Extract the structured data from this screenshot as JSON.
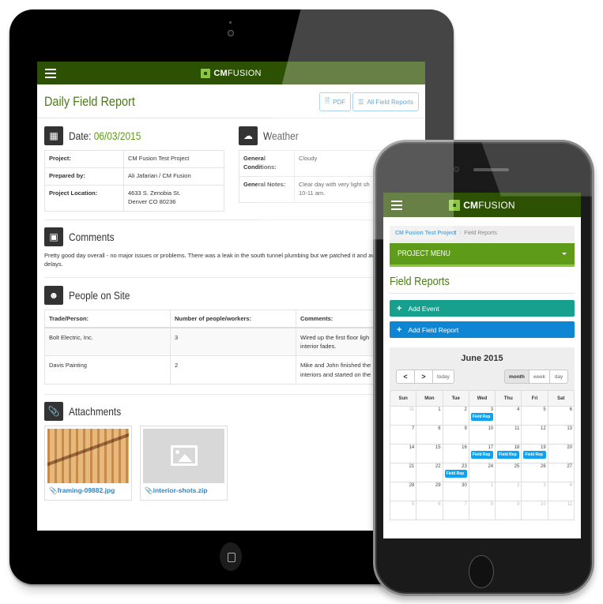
{
  "tablet": {
    "brand": {
      "bold": "CM",
      "rest": "FUSION"
    },
    "page_title": "Daily Field Report",
    "buttons": {
      "pdf": "PDF",
      "all_reports": "All Field Reports"
    },
    "date_section": {
      "label": "Date:",
      "value": "06/03/2015",
      "rows": [
        {
          "key": "Project:",
          "value": "CM Fusion Test Project"
        },
        {
          "key": "Prepared by:",
          "value": "Ali Jafarian / CM Fusion"
        },
        {
          "key": "Project Location:",
          "value": "4633 S. Zenobia St.",
          "value2": "Denver CO 80236"
        }
      ]
    },
    "weather_section": {
      "title": "Weather",
      "rows": [
        {
          "key": "General Conditions:",
          "value": "Cloudy"
        },
        {
          "key": "General Notes:",
          "value": "Clear day with very light sh",
          "value2": "10-11 am."
        }
      ]
    },
    "comments_section": {
      "title": "Comments",
      "text": "Pretty good day overall - no major issues or problems. There was a leak in the south tunnel plumbing but we patched it and avoided further delays."
    },
    "people_section": {
      "title": "People on Site",
      "headers": [
        "Trade/Person:",
        "Number of people/workers:",
        "Comments:"
      ],
      "rows": [
        {
          "trade": "Bolt Electric, Inc.",
          "count": "3",
          "comment": "Wired up the first floor ligh",
          "comment2": "interior fades."
        },
        {
          "trade": "Davis Painting",
          "count": "2",
          "comment": "Mike and John finished the",
          "comment2": "interiors and started on the"
        }
      ]
    },
    "attachments_section": {
      "title": "Attachments",
      "files": [
        {
          "name": "framing-09882.jpg",
          "thumb": "photo"
        },
        {
          "name": "interior-shots.zip",
          "thumb": "placeholder"
        }
      ]
    }
  },
  "phone": {
    "brand": {
      "bold": "CM",
      "rest": "FUSION"
    },
    "breadcrumb": {
      "project": "CM Fusion Test Project",
      "current": "Field Reports"
    },
    "project_menu": "PROJECT MENU",
    "page_title": "Field Reports",
    "buttons": {
      "add_event": "Add Event",
      "add_field_report": "Add Field Report"
    },
    "colors": {
      "add_event": "#17a08e",
      "add_field_report": "#0e86d4",
      "event": "#0fa2f2"
    },
    "calendar": {
      "title": "June 2015",
      "nav": {
        "prev": "<",
        "next": ">",
        "today": "today"
      },
      "views": [
        "month",
        "week",
        "day"
      ],
      "active_view": "month",
      "weekdays": [
        "Sun",
        "Mon",
        "Tue",
        "Wed",
        "Thu",
        "Fri",
        "Sat"
      ],
      "weeks": [
        [
          {
            "d": "31",
            "o": true
          },
          {
            "d": "1"
          },
          {
            "d": "2"
          },
          {
            "d": "3",
            "e": "Field Rep"
          },
          {
            "d": "4"
          },
          {
            "d": "5"
          },
          {
            "d": "6"
          }
        ],
        [
          {
            "d": "7"
          },
          {
            "d": "8"
          },
          {
            "d": "9"
          },
          {
            "d": "10"
          },
          {
            "d": "11"
          },
          {
            "d": "12"
          },
          {
            "d": "13"
          }
        ],
        [
          {
            "d": "14"
          },
          {
            "d": "15"
          },
          {
            "d": "16"
          },
          {
            "d": "17",
            "e": "Field Rep"
          },
          {
            "d": "18",
            "e": "Field Rep"
          },
          {
            "d": "19",
            "e": "Field Rep"
          },
          {
            "d": "20"
          }
        ],
        [
          {
            "d": "21"
          },
          {
            "d": "22"
          },
          {
            "d": "23",
            "e": "Field Rep"
          },
          {
            "d": "24"
          },
          {
            "d": "25"
          },
          {
            "d": "26"
          },
          {
            "d": "27"
          }
        ],
        [
          {
            "d": "28"
          },
          {
            "d": "29"
          },
          {
            "d": "30"
          },
          {
            "d": "1",
            "o": true
          },
          {
            "d": "2",
            "o": true
          },
          {
            "d": "3",
            "o": true
          },
          {
            "d": "4",
            "o": true
          }
        ],
        [
          {
            "d": "5",
            "o": true
          },
          {
            "d": "6",
            "o": true
          },
          {
            "d": "7",
            "o": true
          },
          {
            "d": "8",
            "o": true
          },
          {
            "d": "9",
            "o": true
          },
          {
            "d": "10",
            "o": true
          },
          {
            "d": "11",
            "o": true
          }
        ]
      ]
    }
  }
}
